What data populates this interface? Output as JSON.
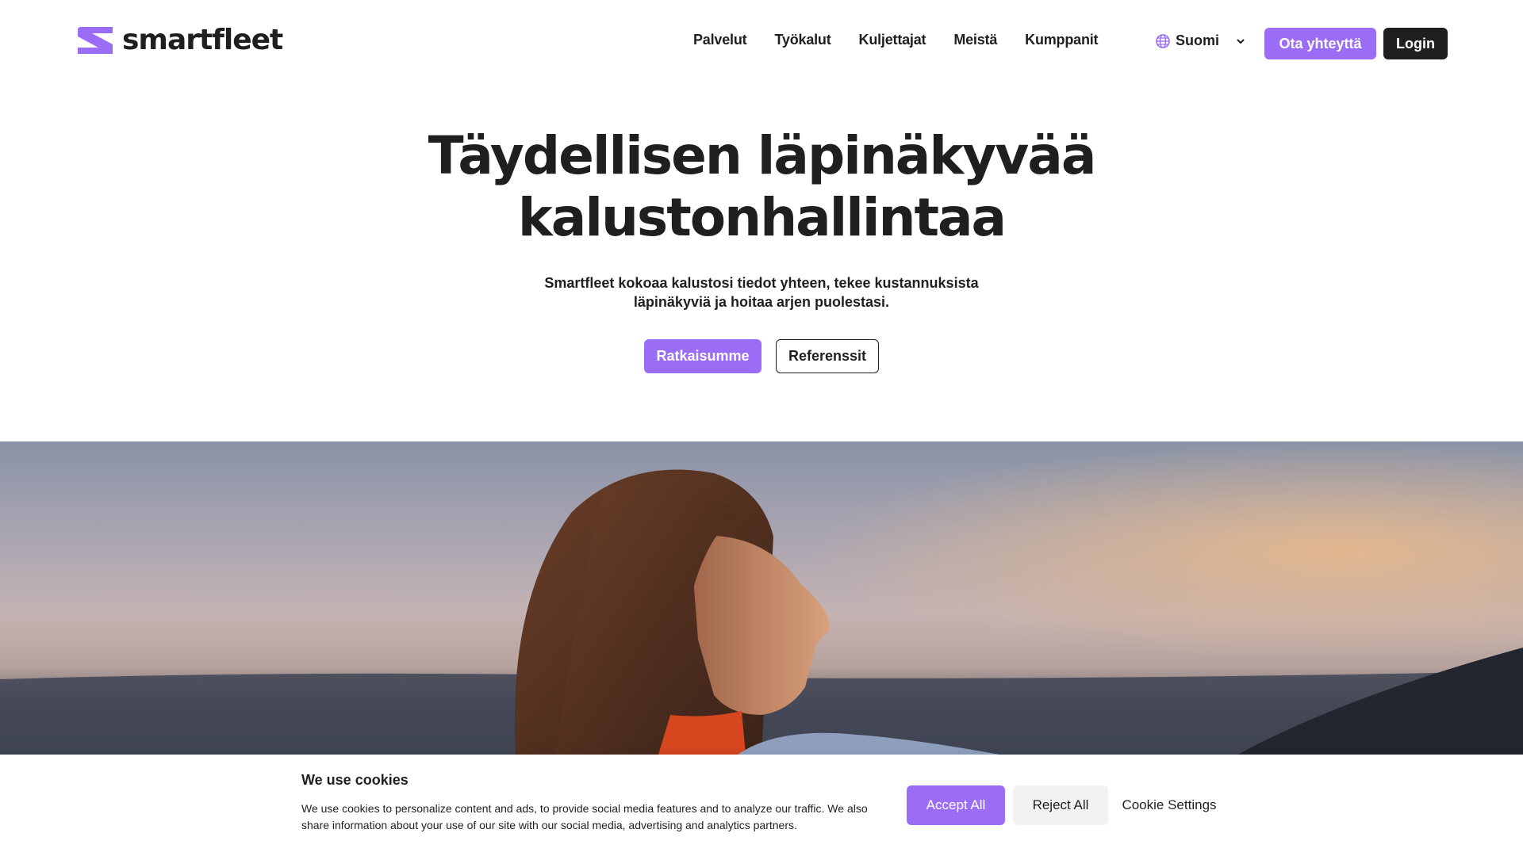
{
  "header": {
    "logo_text": "smartfleet",
    "nav": [
      "Palvelut",
      "Työkalut",
      "Kuljettajat",
      "Meistä",
      "Kumppanit"
    ],
    "language": "Suomi",
    "contact_label": "Ota yhteyttä",
    "login_label": "Login"
  },
  "hero": {
    "title_lines": [
      "Täydellisen läpinäkyvää",
      "kalustonhallintaa"
    ],
    "subtitle_lines": [
      "Smartfleet kokoaa kalustosi tiedot yhteen, tekee kustannuksista",
      "läpinäkyviä ja hoitaa arjen puolestasi."
    ],
    "primary_cta": "Ratkaisumme",
    "secondary_cta": "Referenssit"
  },
  "cookie_banner": {
    "title": "We use cookies",
    "text": "We use cookies to personalize content and ads, to provide social media features and to analyze our traffic. We also share information about your use of our site with our social media, advertising and analytics partners.",
    "accept_label": "Accept All",
    "reject_label": "Reject All",
    "settings_label": "Cookie Settings"
  },
  "colors": {
    "accent": "#9b6df6",
    "dark": "#1f1f1f"
  },
  "icons": {
    "logo": "smartfleet-logo-icon",
    "language": "globe-icon",
    "dropdown": "chevron-down-icon"
  }
}
